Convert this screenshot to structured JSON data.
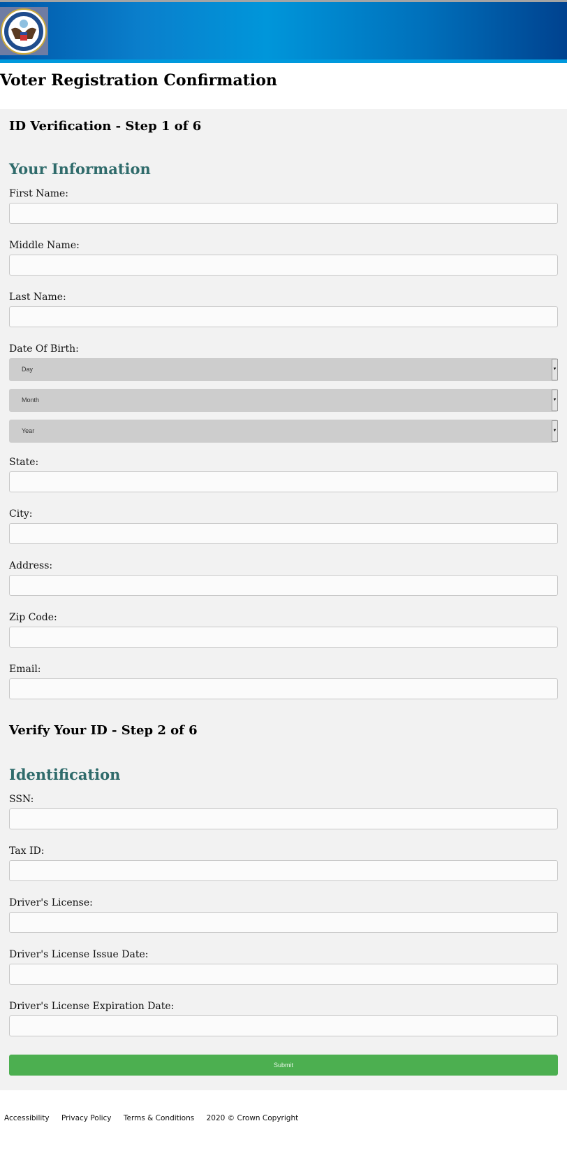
{
  "header": {
    "logo_text": "Election Assistance Commission - United States of America",
    "colors": {
      "header_blue": "#0096da",
      "strip": "#0099dd"
    }
  },
  "page_title": "Voter Registration Confirmation",
  "step1": {
    "heading": "ID Verification - Step 1 of 6",
    "section": "Your Information",
    "fields": [
      {
        "label": "First Name:"
      },
      {
        "label": "Middle Name:"
      },
      {
        "label": "Last Name:"
      }
    ],
    "dob": {
      "label": "Date Of Birth:",
      "selects": [
        "Day",
        "Month",
        "Year"
      ]
    },
    "fields2": [
      {
        "label": "State:"
      },
      {
        "label": "City:"
      },
      {
        "label": "Address:"
      },
      {
        "label": "Zip Code:"
      },
      {
        "label": "Email:"
      }
    ]
  },
  "step2": {
    "heading": "Verify Your ID - Step 2 of 6",
    "section": "Identification",
    "fields": [
      {
        "label": "SSN:"
      },
      {
        "label": "Tax ID:"
      },
      {
        "label": "Driver's License:"
      },
      {
        "label": "Driver's License Issue Date:"
      },
      {
        "label": "Driver's License Expiration Date:"
      }
    ]
  },
  "submit_label": "Submit",
  "footer": {
    "links": [
      "Accessibility",
      "Privacy Policy",
      "Terms & Conditions"
    ],
    "copyright": "2020 © Crown Copyright"
  }
}
